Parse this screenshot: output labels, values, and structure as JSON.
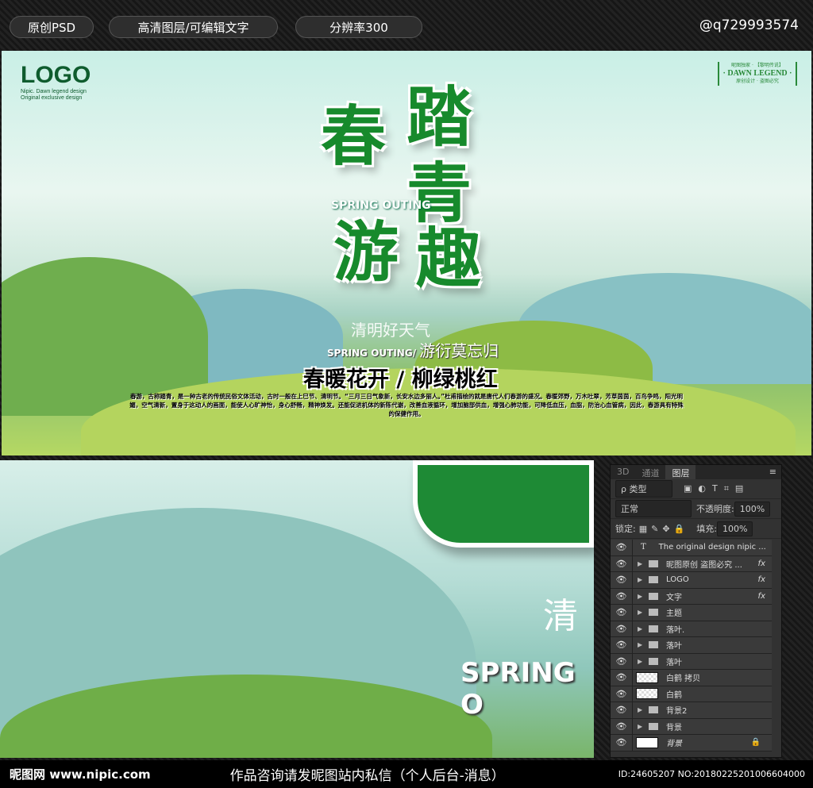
{
  "topbar": {
    "badges": [
      "原创PSD",
      "高清图层/可编辑文字",
      "分辨率300"
    ],
    "author": "@q729993574"
  },
  "poster": {
    "logo": "LOGO",
    "logo_line1": "Nipic. Dawn legend design",
    "logo_line2": "Original exclusive design",
    "brand_top": "昵图独家 · 【黎明传说】",
    "brand_name": "· DAWN LEGEND ·",
    "brand_bottom": "原创设计 · 盗图必究",
    "title_chars": [
      "春",
      "踏",
      "青",
      "游",
      "趣"
    ],
    "title_en": "SPRING OUTING",
    "sub1": "清明好天气",
    "sub2_en": "SPRING OUTING/",
    "sub2": "游衍莫忘归",
    "slogan": "春暖花开 / 柳绿桃红",
    "body": "春游，古称踏青，是一种古老的传统民俗文体活动，古时一般在上巳节、清明节。“三月三日气象新，长安水边多丽人。”杜甫描绘的就是唐代人们春游的盛况。春暖郊野，万木吐翠，芳草茵茵，百鸟争鸣，阳光明媚，空气清新，置身于这动人的画面，能使人心旷神怡，身心舒畅，精神焕发。还能促进机体的新陈代谢，改善血液循环，增加脑部供血，增强心肺功能，可降低血压，血脂，防治心血管病，因此，春游具有特殊的保健作用。"
  },
  "lower": {
    "big_char": "清",
    "big_en": "SPRING O"
  },
  "panel": {
    "tabs": [
      "3D",
      "通道",
      "图层"
    ],
    "filter": "ρ 类型",
    "blend": "正常",
    "opacity_label": "不透明度:",
    "opacity": "100%",
    "lock_label": "锁定:",
    "fill_label": "填充:",
    "fill": "100%",
    "layers": [
      {
        "name": "The original design nipic ...",
        "type": "text"
      },
      {
        "name": "昵图原创 盗图必究 ...",
        "type": "folder",
        "fx": "fx"
      },
      {
        "name": "LOGO",
        "type": "folder",
        "fx": "fx"
      },
      {
        "name": "文字",
        "type": "folder",
        "fx": "fx"
      },
      {
        "name": "主题",
        "type": "folder"
      },
      {
        "name": "落叶.",
        "type": "folder"
      },
      {
        "name": "落叶",
        "type": "folder"
      },
      {
        "name": "落叶",
        "type": "folder"
      },
      {
        "name": "白鹤 拷贝",
        "type": "pixel"
      },
      {
        "name": "白鹤",
        "type": "pixel"
      },
      {
        "name": "背景2",
        "type": "folder"
      },
      {
        "name": "背景",
        "type": "folder"
      },
      {
        "name": "背景",
        "type": "background"
      }
    ]
  },
  "footer": {
    "site": "昵图网 www.nipic.com",
    "notice": "作品咨询请发昵图站内私信（个人后台-消息）",
    "id": "ID:24605207 NO:20180225201006604000"
  }
}
